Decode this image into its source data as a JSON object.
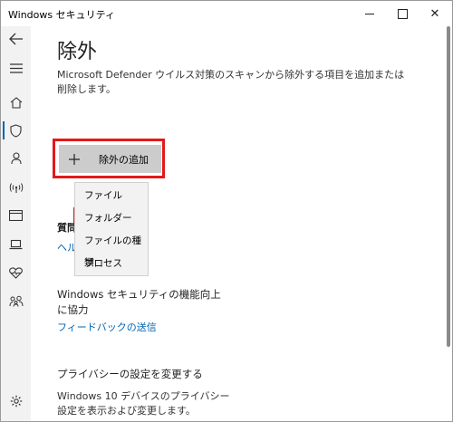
{
  "window": {
    "title": "Windows セキュリティ",
    "minimize_icon": "minimize-icon",
    "maximize_icon": "maximize-icon",
    "close_icon": "close-icon",
    "close_glyph": "✕"
  },
  "sidebar": {
    "items": [
      {
        "icon": "back-arrow-icon"
      },
      {
        "icon": "hamburger-menu-icon"
      },
      {
        "icon": "home-icon"
      },
      {
        "icon": "shield-icon",
        "active": true
      },
      {
        "icon": "person-icon"
      },
      {
        "icon": "wireless-icon"
      },
      {
        "icon": "app-browser-icon"
      },
      {
        "icon": "laptop-icon"
      },
      {
        "icon": "heart-icon"
      },
      {
        "icon": "family-icon"
      },
      {
        "icon": "settings-gear-icon"
      }
    ],
    "accent_color": "#0063b1"
  },
  "main": {
    "title": "除外",
    "description": "Microsoft Defender ウイルス対策のスキャンから除外する項目を追加または削除します。",
    "add_button": {
      "label": "除外の追加",
      "icon": "plus-icon",
      "highlight_color": "#e2191a"
    },
    "partial_heading": "質問",
    "partial_link": "ヘル",
    "dropdown": {
      "items": [
        "ファイル",
        "フォルダー",
        "ファイルの種類",
        "プロセス"
      ]
    },
    "improve_section": {
      "title": "Windows セキュリティの機能向上に協力",
      "link": "フィードバックの送信"
    },
    "privacy_section": {
      "title": "プライバシーの設定を変更する",
      "description": "Windows 10 デバイスのプライバシー設定を表示および変更します。"
    }
  }
}
